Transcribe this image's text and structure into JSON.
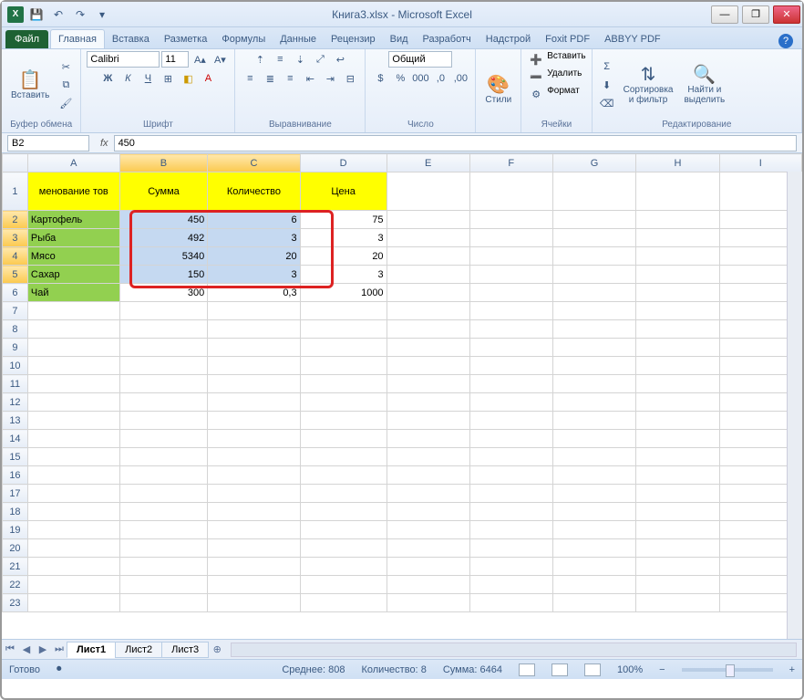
{
  "title": "Книга3.xlsx - Microsoft Excel",
  "tabs": {
    "file": "Файл",
    "list": [
      "Главная",
      "Вставка",
      "Разметка",
      "Формулы",
      "Данные",
      "Рецензир",
      "Вид",
      "Разработч",
      "Надстрой",
      "Foxit PDF",
      "ABBYY PDF"
    ],
    "active": 0
  },
  "ribbon": {
    "clipboard": {
      "paste": "Вставить",
      "label": "Буфер обмена"
    },
    "font": {
      "name": "Calibri",
      "size": "11",
      "label": "Шрифт"
    },
    "align": {
      "label": "Выравнивание"
    },
    "number": {
      "format": "Общий",
      "label": "Число"
    },
    "styles": {
      "btn": "Стили",
      "label": ""
    },
    "cells": {
      "insert": "Вставить",
      "delete": "Удалить",
      "format": "Формат",
      "label": "Ячейки"
    },
    "editing": {
      "sort": "Сортировка\nи фильтр",
      "find": "Найти и\nвыделить",
      "label": "Редактирование"
    }
  },
  "fbar": {
    "name": "B2",
    "formula": "450"
  },
  "columns": [
    "",
    "A",
    "B",
    "C",
    "D",
    "E",
    "F",
    "G",
    "H",
    "I"
  ],
  "headers": {
    "a": "менование тов",
    "b": "Сумма",
    "c": "Количество",
    "d": "Цена"
  },
  "rows": [
    {
      "a": "Картофель",
      "b": "450",
      "c": "6",
      "d": "75"
    },
    {
      "a": "Рыба",
      "b": "492",
      "c": "3",
      "d": "3"
    },
    {
      "a": "Мясо",
      "b": "5340",
      "c": "20",
      "d": "20"
    },
    {
      "a": "Сахар",
      "b": "150",
      "c": "3",
      "d": "3"
    },
    {
      "a": "Чай",
      "b": "300",
      "c": "0,3",
      "d": "1000"
    }
  ],
  "sheets": [
    "Лист1",
    "Лист2",
    "Лист3"
  ],
  "status": {
    "ready": "Готово",
    "avg_lbl": "Среднее:",
    "avg": "808",
    "cnt_lbl": "Количество:",
    "cnt": "8",
    "sum_lbl": "Сумма:",
    "sum": "6464",
    "zoom": "100%"
  },
  "chart_data": {
    "type": "table",
    "columns": [
      "Наименование товара",
      "Сумма",
      "Количество",
      "Цена"
    ],
    "rows": [
      [
        "Картофель",
        450,
        6,
        75
      ],
      [
        "Рыба",
        492,
        3,
        3
      ],
      [
        "Мясо",
        5340,
        20,
        20
      ],
      [
        "Сахар",
        150,
        3,
        3
      ],
      [
        "Чай",
        300,
        0.3,
        1000
      ]
    ],
    "selection": "B2:C5",
    "aggregates": {
      "average": 808,
      "count": 8,
      "sum": 6464
    }
  }
}
